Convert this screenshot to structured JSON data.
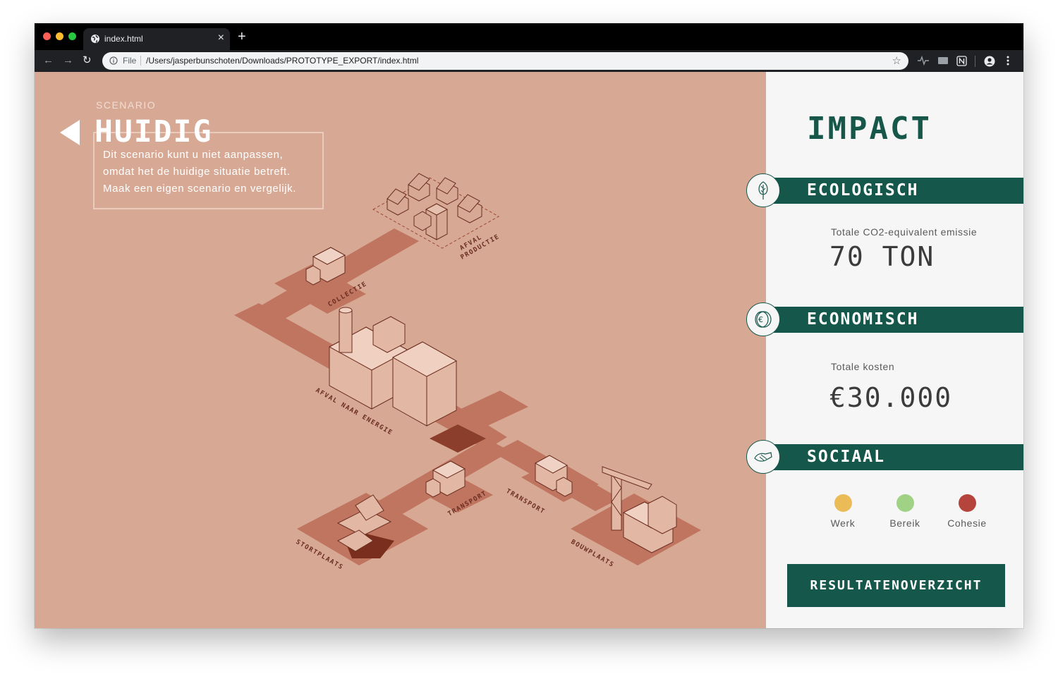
{
  "browser": {
    "tab_title": "index.html",
    "tab_close": "×",
    "new_tab": "+",
    "url_scheme": "File",
    "url": "/Users/jasperbunschoten/Downloads/PROTOTYPE_EXPORT/index.html",
    "icons": [
      "globe-icon",
      "info-icon",
      "star-icon",
      "back-icon",
      "forward-icon",
      "reload-icon",
      "account-icon",
      "menu-icon"
    ]
  },
  "scenario": {
    "label": "SCENARIO",
    "title": "HUIDIG",
    "description": [
      "Dit scenario kunt u niet aanpassen,",
      "omdat het de huidige situatie betreft.",
      "Maak een eigen scenario en vergelijk."
    ]
  },
  "map": {
    "labels": {
      "afval_productie_1": "AFVAL",
      "afval_productie_2": "PRODUCTIE",
      "collectie": "COLLECTIE",
      "afval_naar_energie": "AFVAL NAAR ENERGIE",
      "transport_left": "TRANSPORT",
      "transport_right": "TRANSPORT",
      "stortplaats": "STORTPLAATS",
      "bouwplaats": "BOUWPLAATS"
    },
    "colors": {
      "background": "#d7a994",
      "road": "#c07560",
      "line": "#6b2d20"
    }
  },
  "impact": {
    "title": "IMPACT",
    "ecologisch": {
      "label": "ECOLOGISCH",
      "metric_label": "Totale CO2-equivalent emissie",
      "metric_value": "70 TON"
    },
    "economisch": {
      "label": "ECONOMISCH",
      "metric_label": "Totale kosten",
      "metric_value": "€30.000"
    },
    "sociaal": {
      "label": "SOCIAAL",
      "items": [
        {
          "label": "Werk",
          "color": "#ebbb58"
        },
        {
          "label": "Bereik",
          "color": "#9fd285"
        },
        {
          "label": "Cohesie",
          "color": "#b5453c"
        }
      ]
    },
    "button_label": "RESULTATENOVERZICHT",
    "accent_color": "#16574b"
  }
}
